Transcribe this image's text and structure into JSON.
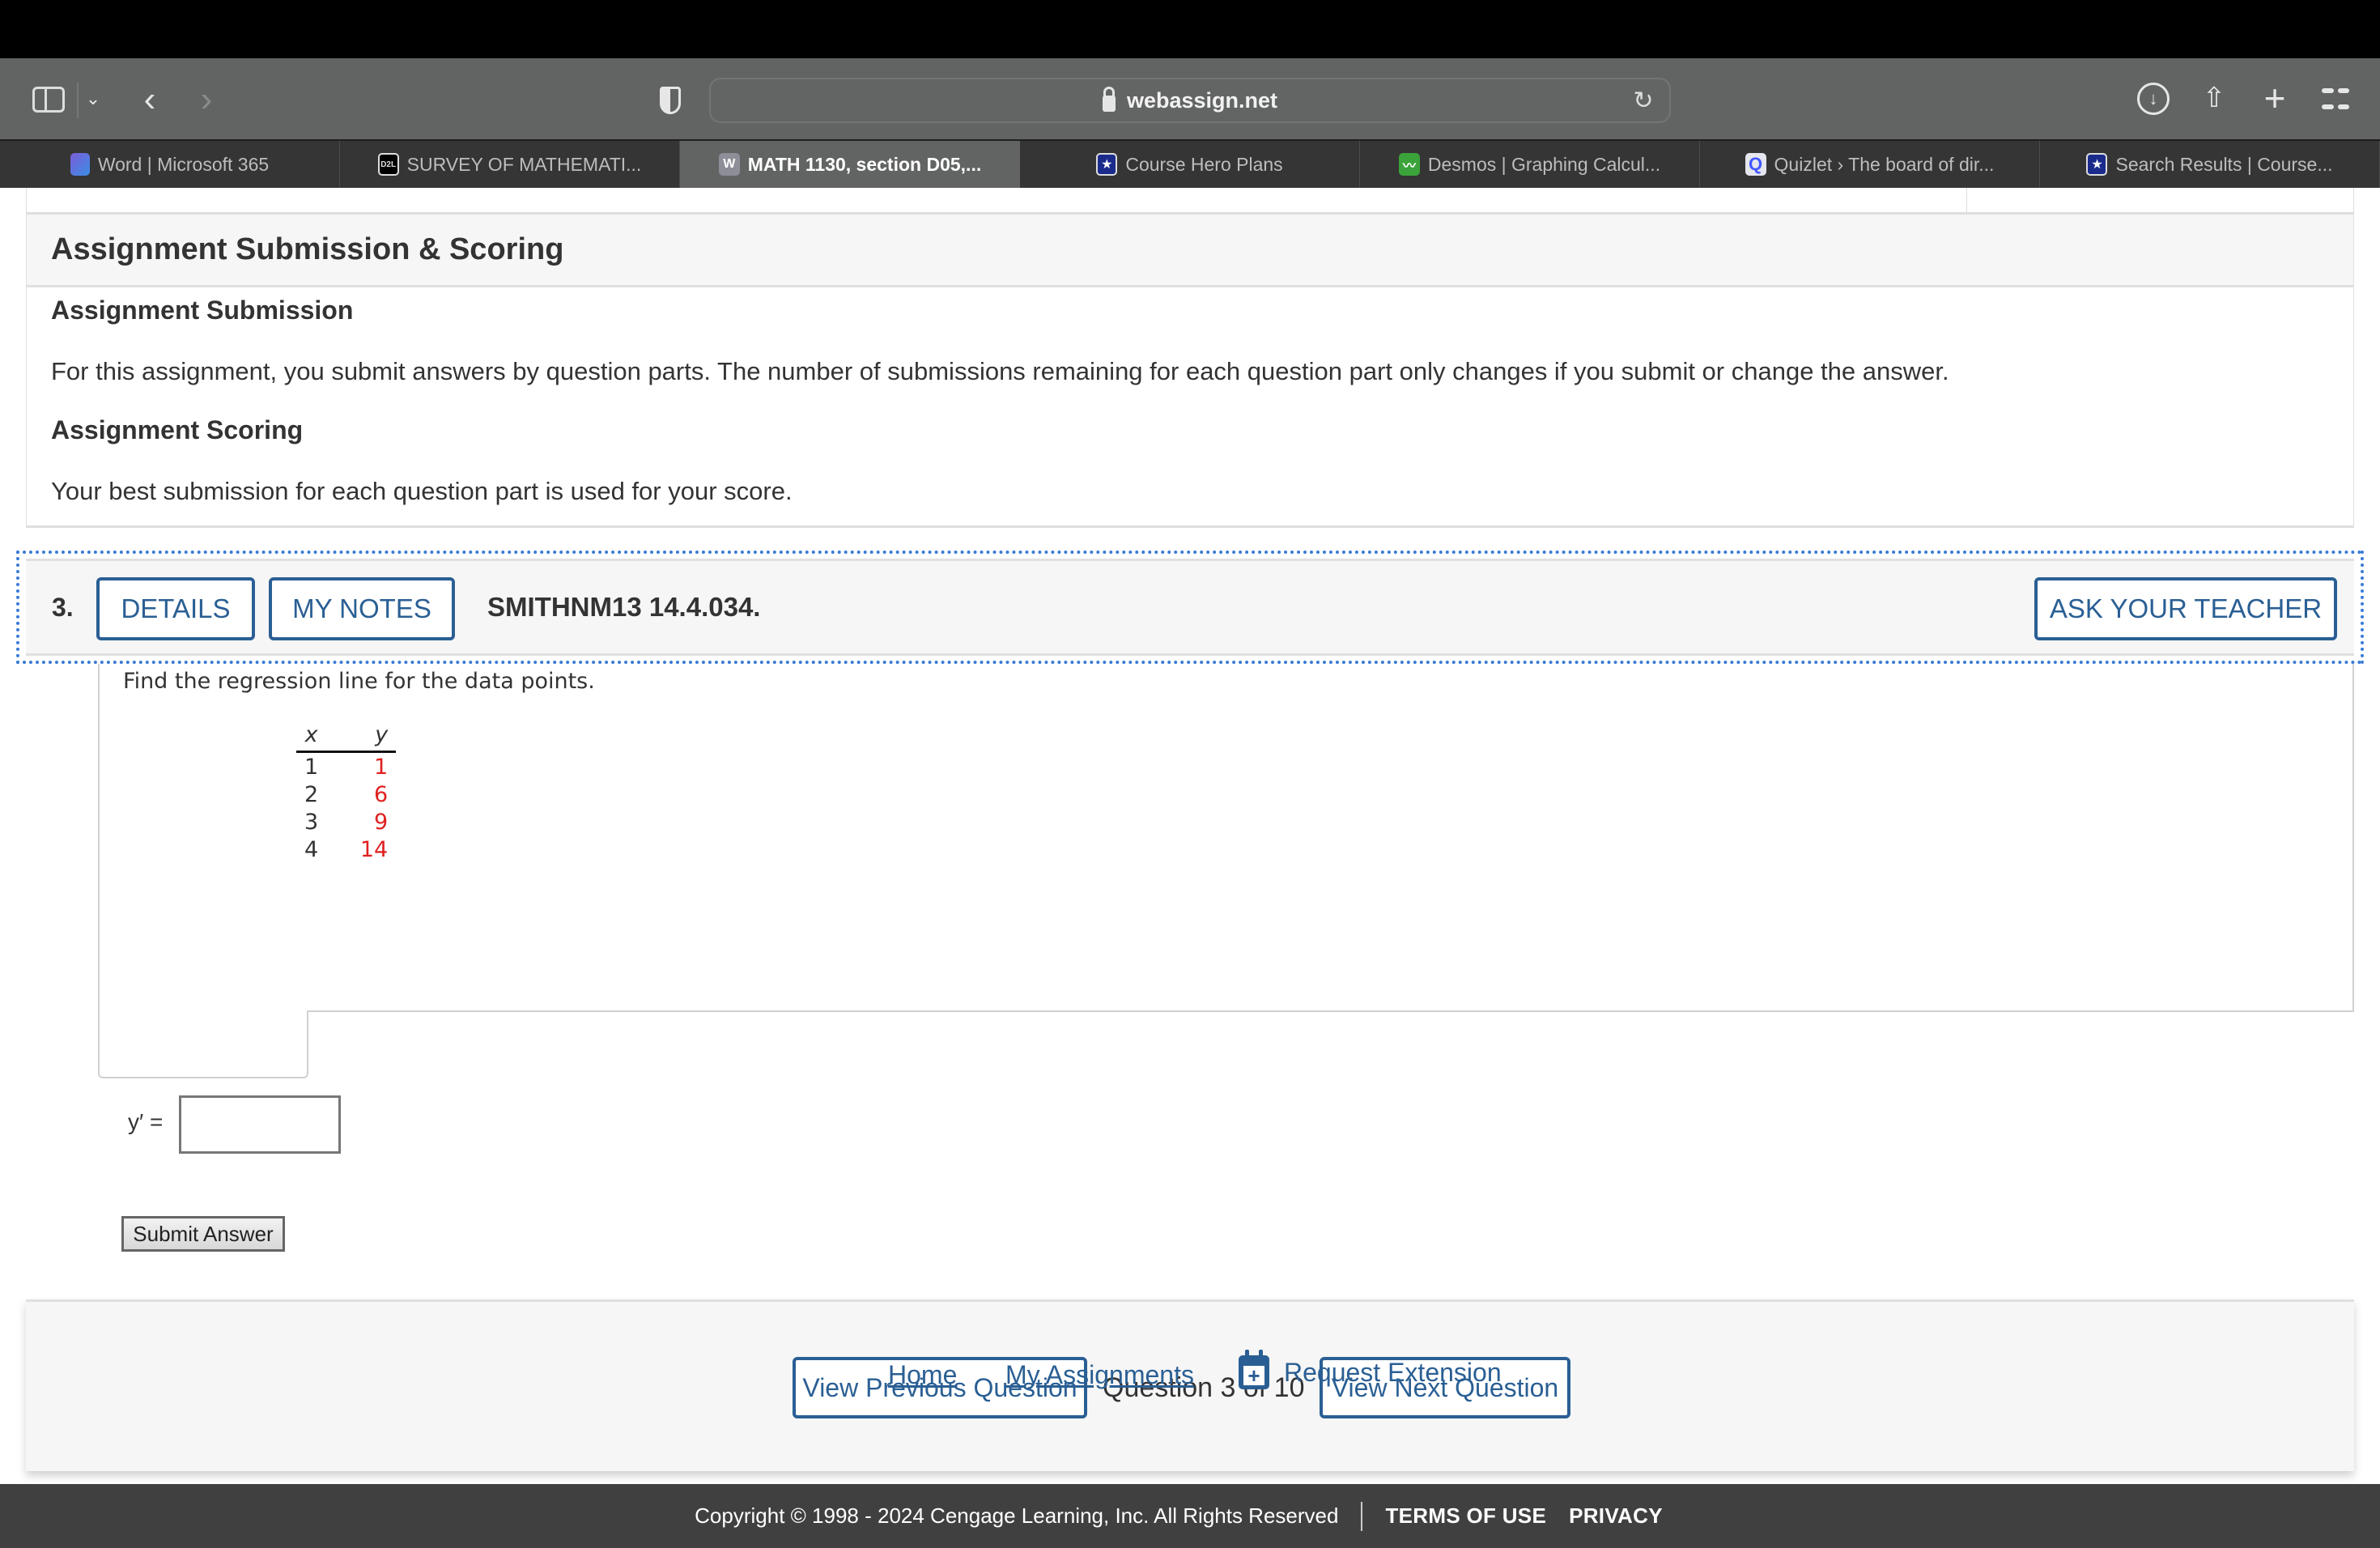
{
  "browser": {
    "url": "webassign.net",
    "tabs": [
      {
        "label": "Word | Microsoft 365",
        "icon": "microsoft-365-icon",
        "active": false
      },
      {
        "label": "SURVEY OF MATHEMATI...",
        "icon": "d2l-icon",
        "icon_text": "D2L",
        "active": false
      },
      {
        "label": "MATH 1130, section D05,...",
        "icon": "webassign-icon",
        "icon_text": "W",
        "active": true
      },
      {
        "label": "Course Hero Plans",
        "icon": "course-hero-icon",
        "icon_text": "★",
        "active": false
      },
      {
        "label": "Desmos | Graphing Calcul...",
        "icon": "desmos-icon",
        "icon_text": "〰",
        "active": false
      },
      {
        "label": "Quizlet › The board of dir...",
        "icon": "quizlet-icon",
        "icon_text": "Q",
        "active": false
      },
      {
        "label": "Search Results | Course...",
        "icon": "course-hero-icon",
        "icon_text": "★",
        "active": false
      }
    ],
    "toolbar_icons": {
      "back": "‹",
      "forward": "›",
      "chevron": "⌄",
      "reload": "↻",
      "download": "↓",
      "share": "⇧",
      "new_tab": "+"
    }
  },
  "assignment_info": {
    "title": "Assignment Submission & Scoring",
    "submission_heading": "Assignment Submission",
    "submission_text": "For this assignment, you submit answers by question parts. The number of submissions remaining for each question part only changes if you submit or change the answer.",
    "scoring_heading": "Assignment Scoring",
    "scoring_text": "Your best submission for each question part is used for your score."
  },
  "question": {
    "number": "3.",
    "details_label": "DETAILS",
    "notes_label": "MY NOTES",
    "code": "SMITHNM13 14.4.034.",
    "ask_teacher_label": "ASK YOUR TEACHER",
    "prompt": "Find the regression line for the data points.",
    "table": {
      "headers": [
        "x",
        "y"
      ],
      "rows": [
        {
          "x": "1",
          "y": "1"
        },
        {
          "x": "2",
          "y": "6"
        },
        {
          "x": "3",
          "y": "9"
        },
        {
          "x": "4",
          "y": "14"
        }
      ]
    },
    "answer_label": "y′ =",
    "answer_value": "",
    "submit_label": "Submit Answer"
  },
  "navigation": {
    "prev_label": "View Previous Question",
    "position_text": "Question 3 of 10",
    "next_label": "View Next Question"
  },
  "footer_links": {
    "home": "Home",
    "my_assignments": "My Assignments",
    "request_extension": "Request Extension"
  },
  "footer": {
    "copyright": "Copyright © 1998 - 2024 Cengage Learning, Inc. All Rights Reserved",
    "terms": "TERMS OF USE",
    "privacy": "PRIVACY"
  },
  "colors": {
    "brand_blue": "#2a5f94",
    "focus_outline": "#3a7bd5",
    "data_red": "#e02020",
    "footer_bg": "#404040"
  }
}
